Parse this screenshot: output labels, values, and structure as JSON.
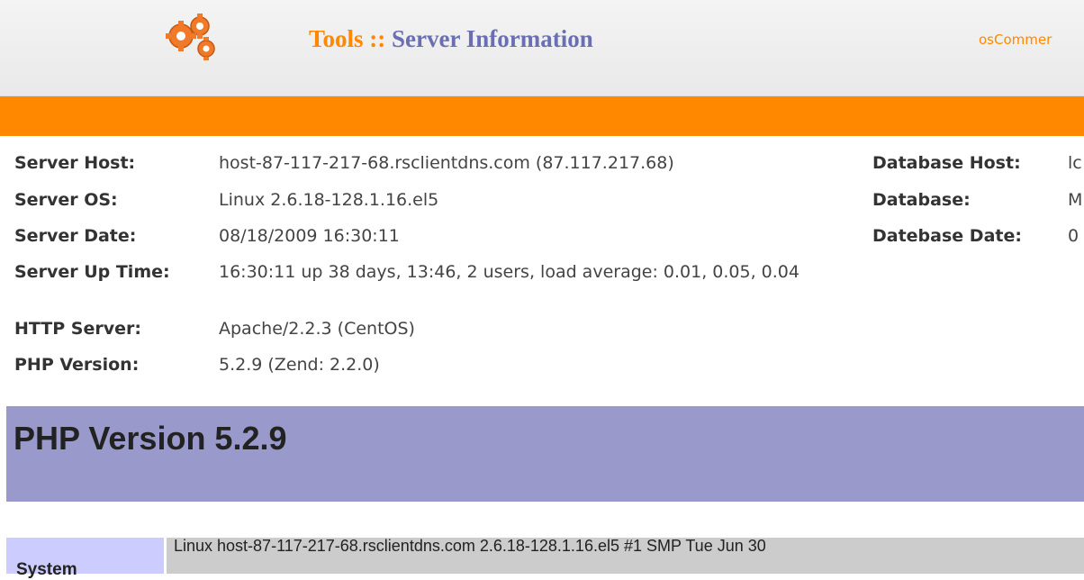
{
  "header": {
    "crumb": "Tools",
    "separator": " :: ",
    "title": "Server Information",
    "link": "osCommer",
    "icon": "gears-icon",
    "colors": {
      "crumb": "#ff8800",
      "title": "#6a6fb3",
      "bar": "#ff8800"
    }
  },
  "server": {
    "host_label": "Server Host:",
    "host_value": "host-87-117-217-68.rsclientdns.com (87.117.217.68)",
    "os_label": "Server OS:",
    "os_value": "Linux 2.6.18-128.1.16.el5",
    "date_label": "Server Date:",
    "date_value": "08/18/2009 16:30:11",
    "uptime_label": "Server Up Time:",
    "uptime_value": "16:30:11 up 38 days, 13:46, 2 users, load average: 0.01, 0.05, 0.04",
    "http_label": "HTTP Server:",
    "http_value": "Apache/2.2.3 (CentOS)",
    "php_label": "PHP Version:",
    "php_value": "5.2.9 (Zend: 2.2.0)"
  },
  "database": {
    "host_label": "Database Host:",
    "host_value": "lc",
    "db_label": "Database:",
    "db_value": "M",
    "date_label": "Datebase Date:",
    "date_value": "0"
  },
  "phpinfo": {
    "heading": "PHP Version 5.2.9",
    "system_label": "System",
    "system_value": "Linux host-87-117-217-68.rsclientdns.com 2.6.18-128.1.16.el5 #1 SMP Tue Jun 30",
    "colors": {
      "banner": "#9999cc",
      "label_bg": "#ccccff",
      "value_bg": "#cccccc"
    }
  }
}
